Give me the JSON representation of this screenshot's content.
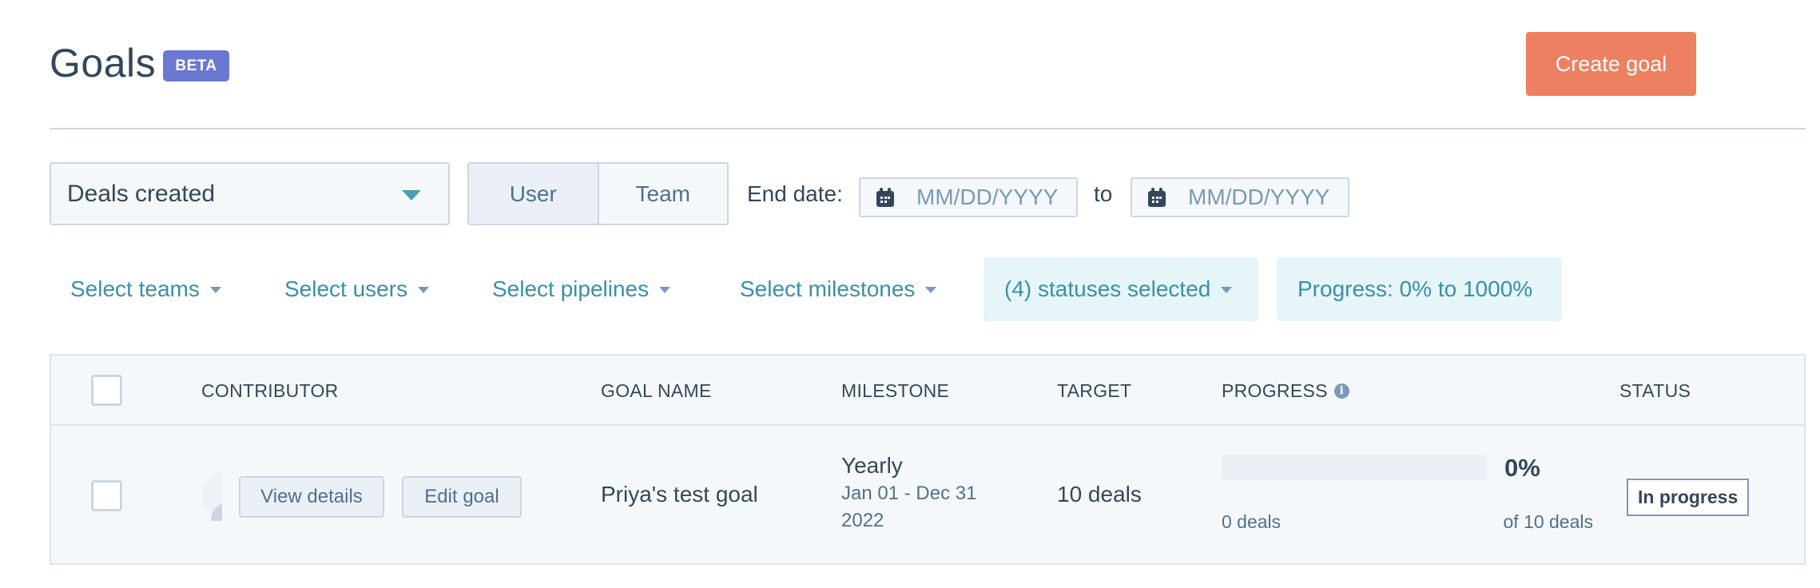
{
  "header": {
    "title": "Goals",
    "badge": "BETA",
    "create_button": "Create goal"
  },
  "controls": {
    "metric_select": {
      "value": "Deals created"
    },
    "view_toggle": [
      {
        "label": "User",
        "active": true
      },
      {
        "label": "Team",
        "active": false
      }
    ],
    "end_date_label": "End date:",
    "date_from": {
      "placeholder": "MM/DD/YYYY",
      "icon": "calendar-icon"
    },
    "to_label": "to",
    "date_to": {
      "placeholder": "MM/DD/YYYY",
      "icon": "calendar-icon"
    }
  },
  "filters": [
    {
      "label": "Select teams",
      "has_caret": true
    },
    {
      "label": "Select users",
      "has_caret": true
    },
    {
      "label": "Select pipelines",
      "has_caret": true
    },
    {
      "label": "Select milestones",
      "has_caret": true
    },
    {
      "label": "(4) statuses selected",
      "has_caret": true,
      "highlighted": true
    },
    {
      "label": "Progress: 0% to 1000%",
      "has_caret": false,
      "highlighted": true
    }
  ],
  "table": {
    "columns": [
      "CONTRIBUTOR",
      "GOAL NAME",
      "MILESTONE",
      "TARGET",
      "PROGRESS",
      "STATUS"
    ],
    "progress_info_icon": "info-icon",
    "rows": [
      {
        "contributor_actions": [
          "View details",
          "Edit goal"
        ],
        "goal_name": "Priya's test goal",
        "milestone_period": "Yearly",
        "milestone_range": "Jan 01 - Dec 31 2022",
        "target": "10 deals",
        "progress_percent": "0%",
        "progress_fraction": 0,
        "progress_current": "0 deals",
        "progress_total": "of 10 deals",
        "status": "In progress"
      }
    ]
  },
  "colors": {
    "primary_cta": "#ed8060",
    "beta_badge": "#6a78d1",
    "link": "#3b8fa9",
    "text": "#33475b",
    "filter_pill_bg": "#e5f5f8"
  }
}
